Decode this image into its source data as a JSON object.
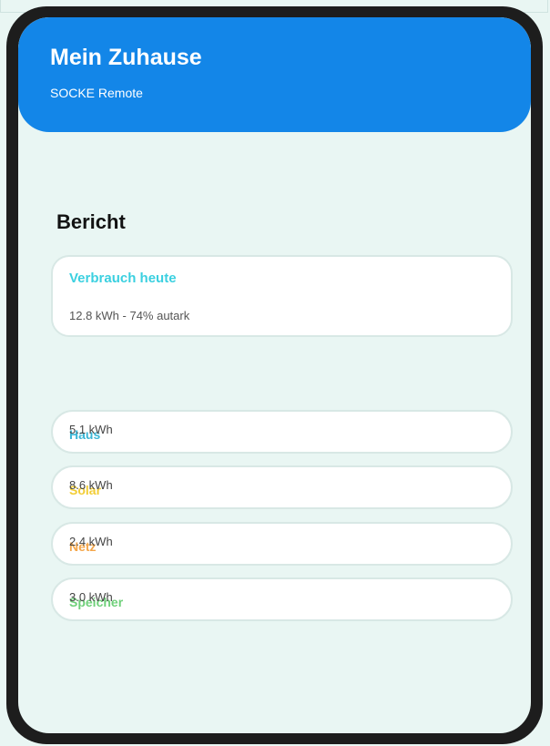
{
  "header": {
    "title": "Mein Zuhause",
    "subtitle": "SOCKE Remote",
    "color": "#1386e8"
  },
  "report": {
    "title": "Bericht",
    "card": {
      "title": "Verbrauch heute",
      "text": "12.8 kWh - 74% autark",
      "title_color": "#3bd0e0"
    }
  },
  "rows": [
    {
      "label": "Haus",
      "value": "5.1 kWh",
      "color": "#3bb6d6"
    },
    {
      "label": "Solar",
      "value": "8.6 kWh",
      "color": "#f2cd35"
    },
    {
      "label": "Netz",
      "value": "2.4 kWh",
      "color": "#f4a64a"
    },
    {
      "label": "Speicher",
      "value": "3.0 kWh",
      "color": "#6fd07a"
    }
  ]
}
